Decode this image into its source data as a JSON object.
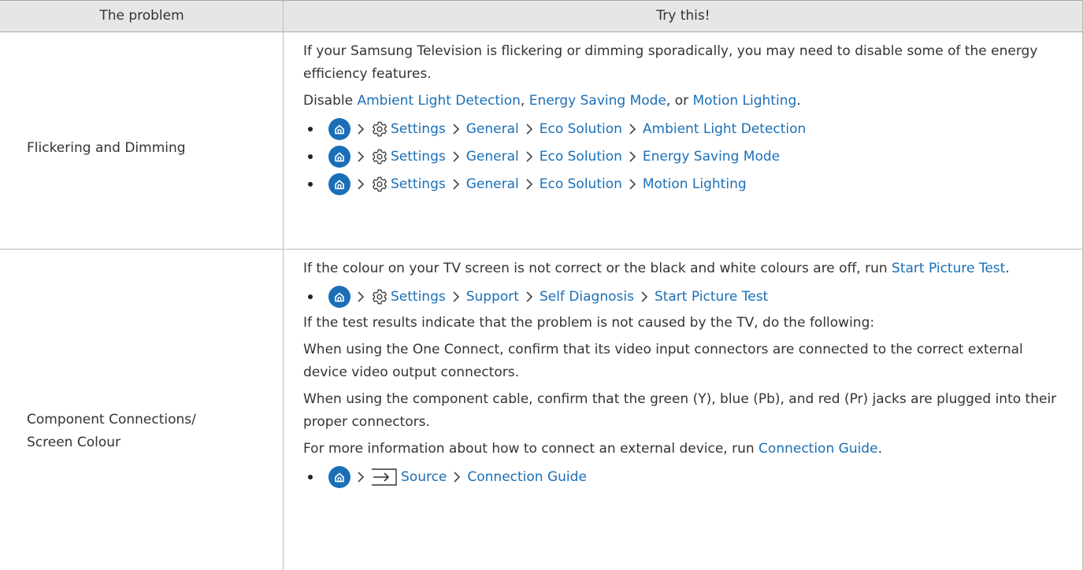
{
  "header": {
    "col_problem": "The problem",
    "col_try": "Try this!"
  },
  "rows": [
    {
      "problem": "Flickering and Dimming",
      "para1": "If your Samsung Television is flickering or dimming sporadically, you may need to disable some of the energy efficiency features.",
      "para2": {
        "prefix": "Disable ",
        "link1": "Ambient Light Detection",
        "mid1": ", ",
        "link2": "Energy Saving Mode",
        "mid2": ", or ",
        "link3": "Motion Lighting",
        "suffix": "."
      },
      "paths": [
        [
          "Settings",
          "General",
          "Eco Solution",
          "Ambient Light Detection"
        ],
        [
          "Settings",
          "General",
          "Eco Solution",
          "Energy Saving Mode"
        ],
        [
          "Settings",
          "General",
          "Eco Solution",
          "Motion Lighting"
        ]
      ]
    },
    {
      "problem_line1": "Component Connections/",
      "problem_line2": "Screen Colour",
      "para1": {
        "prefix": "If the colour on your TV screen is not correct or the black and white colours are off, run ",
        "link": "Start Picture Test",
        "suffix": "."
      },
      "path1": [
        "Settings",
        "Support",
        "Self Diagnosis",
        "Start Picture Test"
      ],
      "para2": "If the test results indicate that the problem is not caused by the TV, do the following:",
      "para3": "When using the One Connect, confirm that its video input connectors are connected to the correct external device video output connectors.",
      "para4": "When using the component cable, confirm that the green (Y), blue (Pb), and red (Pr) jacks are plugged into their proper connectors.",
      "para5": {
        "prefix": "For more information about how to connect an external device, run ",
        "link": "Connection Guide",
        "suffix": "."
      },
      "path2": [
        "Source",
        "Connection Guide"
      ]
    }
  ],
  "icons": {
    "home": "home-icon",
    "settings": "gear-icon",
    "source": "source-icon",
    "separator": "chevron-right-icon"
  },
  "colors": {
    "link": "#1a6fb7",
    "header_bg": "#e6e6e6"
  }
}
